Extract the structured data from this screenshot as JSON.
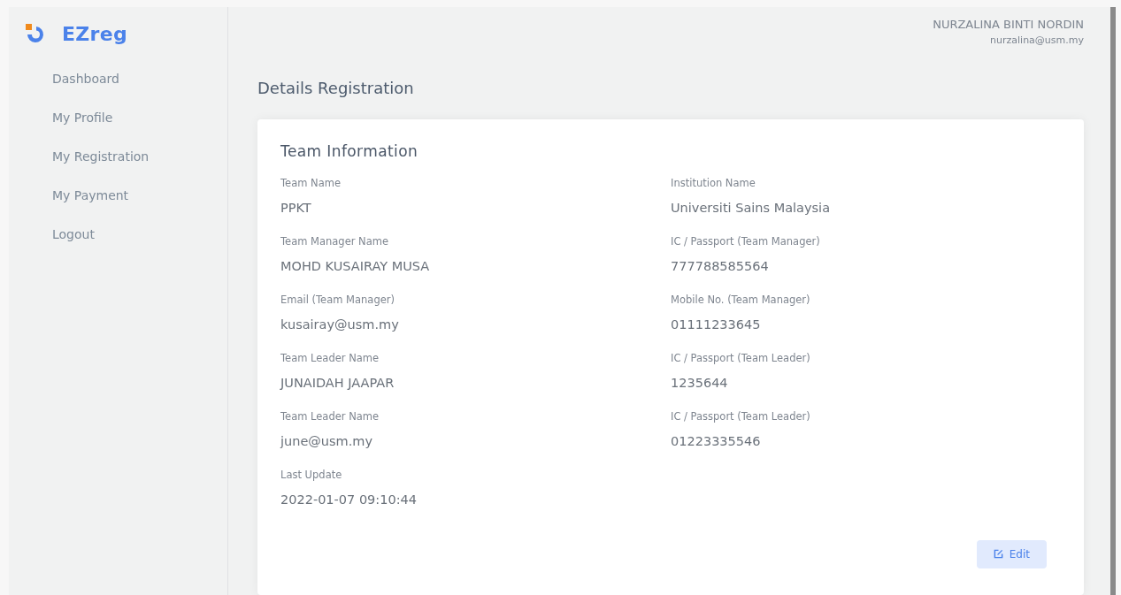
{
  "brand": {
    "name": "EZreg"
  },
  "sidebar": {
    "items": [
      {
        "label": "Dashboard"
      },
      {
        "label": "My Profile"
      },
      {
        "label": "My Registration"
      },
      {
        "label": "My Payment"
      },
      {
        "label": "Logout"
      }
    ]
  },
  "user": {
    "name": "NURZALINA BINTI NORDIN",
    "email": "nurzalina@usm.my"
  },
  "page_title": "Details Registration",
  "card": {
    "title": "Team Information",
    "fields": [
      {
        "label": "Team Name",
        "value": "PPKT"
      },
      {
        "label": "Institution Name",
        "value": "Universiti Sains Malaysia"
      },
      {
        "label": "Team Manager Name",
        "value": "MOHD KUSAIRAY MUSA"
      },
      {
        "label": "IC / Passport (Team Manager)",
        "value": "777788585564"
      },
      {
        "label": "Email (Team Manager)",
        "value": "kusairay@usm.my"
      },
      {
        "label": "Mobile No. (Team Manager)",
        "value": "01111233645"
      },
      {
        "label": "Team Leader Name",
        "value": "JUNAIDAH JAAPAR"
      },
      {
        "label": "IC / Passport (Team Leader)",
        "value": "1235644"
      },
      {
        "label": "Team Leader Name",
        "value": "june@usm.my"
      },
      {
        "label": "IC / Passport (Team Leader)",
        "value": "01223335546"
      },
      {
        "label": "Last Update",
        "value": "2022-01-07 09:10:44"
      }
    ],
    "button": "Edit"
  }
}
